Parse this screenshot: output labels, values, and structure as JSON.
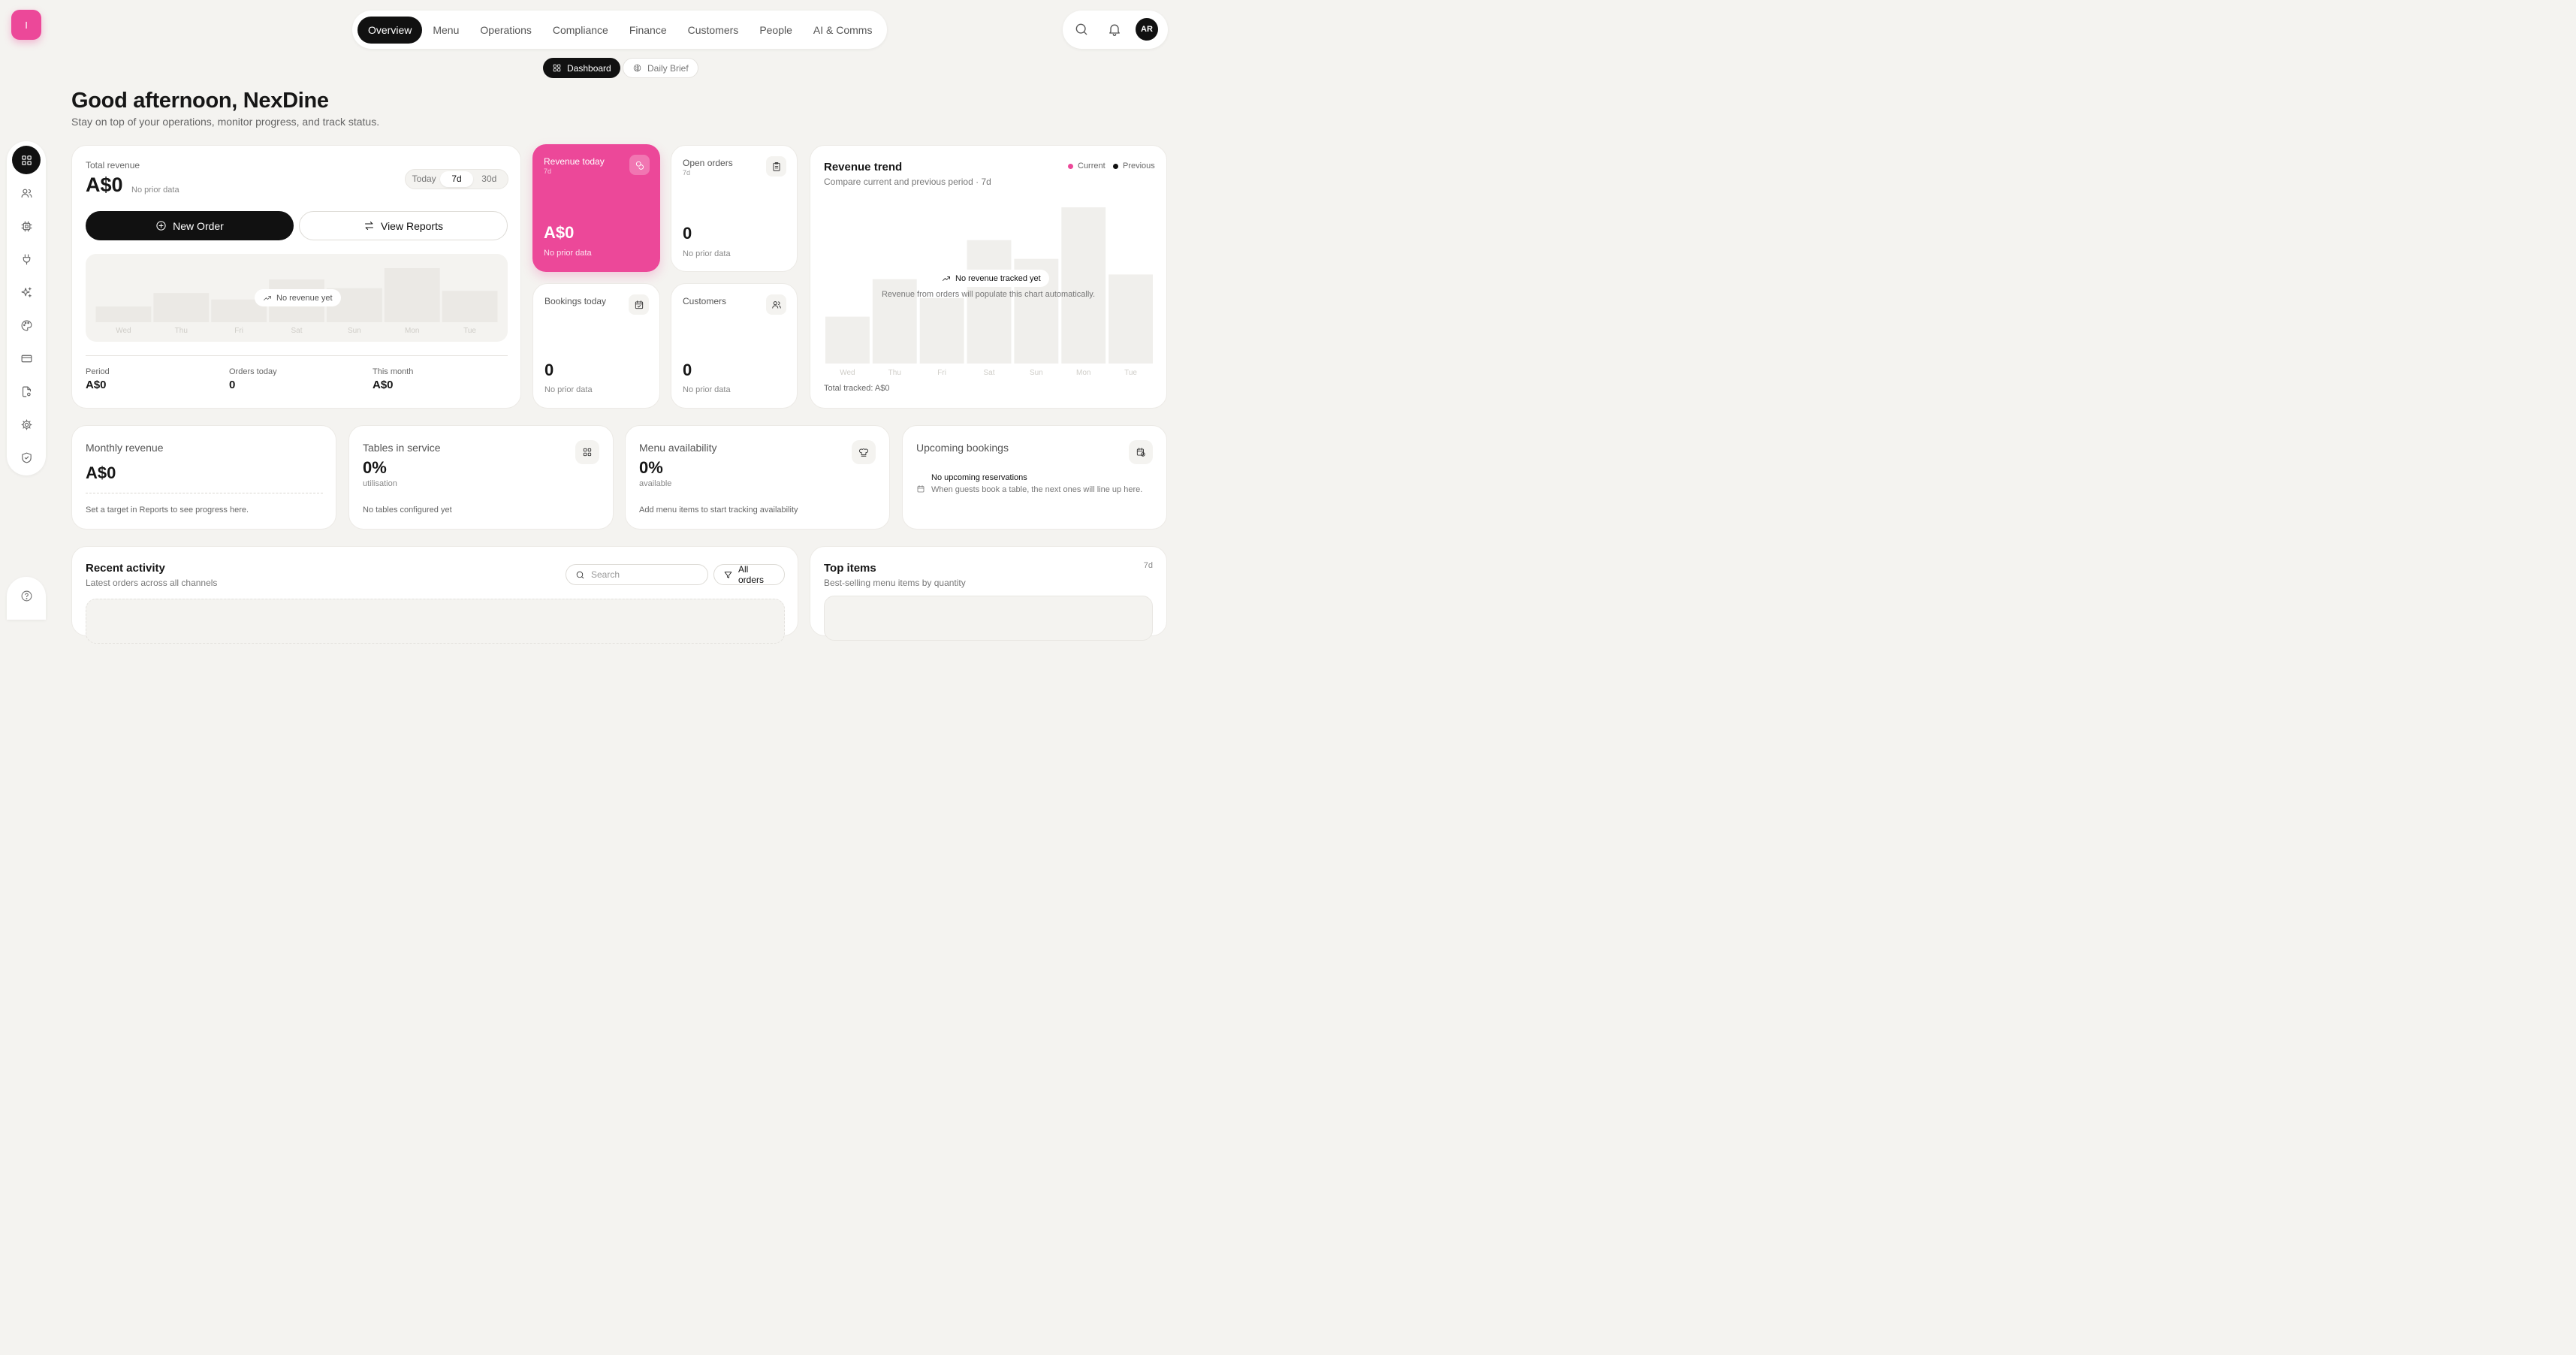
{
  "logo": {
    "letter": "I",
    "color": "#ec4899"
  },
  "nav": {
    "tabs": [
      {
        "label": "Overview",
        "active": true
      },
      {
        "label": "Menu"
      },
      {
        "label": "Operations"
      },
      {
        "label": "Compliance"
      },
      {
        "label": "Finance"
      },
      {
        "label": "Customers"
      },
      {
        "label": "People"
      },
      {
        "label": "AI & Comms"
      }
    ]
  },
  "topright": {
    "search_icon": "search-icon",
    "bell_icon": "bell-icon",
    "avatar": "AR"
  },
  "subtabs": [
    {
      "label": "Dashboard",
      "icon": "grid-icon",
      "active": true
    },
    {
      "label": "Daily Brief",
      "icon": "brain-icon"
    }
  ],
  "greeting": {
    "title": "Good afternoon, NexDine",
    "subtitle": "Stay on top of your operations, monitor progress, and track status."
  },
  "sidebar": {
    "items": [
      {
        "icon": "grid-icon",
        "active": true
      },
      {
        "icon": "users-icon"
      },
      {
        "icon": "chip-icon"
      },
      {
        "icon": "plug-icon"
      },
      {
        "icon": "sparkles-icon"
      },
      {
        "icon": "palette-icon"
      },
      {
        "icon": "card-icon"
      },
      {
        "icon": "file-settings-icon"
      },
      {
        "icon": "gear-icon"
      },
      {
        "icon": "shield-check-icon"
      }
    ],
    "help_icon": "help-icon"
  },
  "total_revenue": {
    "label": "Total revenue",
    "value": "A$0",
    "note": "No prior data",
    "range_options": [
      "Today",
      "7d",
      "30d"
    ],
    "range_selected": "7d",
    "new_order_label": "New Order",
    "view_reports_label": "View Reports",
    "empty_label": "No revenue yet",
    "footer": [
      {
        "label": "Period",
        "value": "A$0"
      },
      {
        "label": "Orders today",
        "value": "0"
      },
      {
        "label": "This month",
        "value": "A$0"
      }
    ]
  },
  "stats": {
    "revenue_today": {
      "title": "Revenue today",
      "period": "7d",
      "value": "A$0",
      "sub": "No prior data"
    },
    "open_orders": {
      "title": "Open orders",
      "period": "7d",
      "value": "0",
      "sub": "No prior data"
    },
    "bookings_today": {
      "title": "Bookings today",
      "value": "0",
      "sub": "No prior data"
    },
    "customers": {
      "title": "Customers",
      "value": "0",
      "sub": "No prior data"
    }
  },
  "revenue_trend": {
    "title": "Revenue trend",
    "subtitle": "Compare current and previous period · 7d",
    "legend": [
      {
        "name": "Current",
        "color": "#ec4899"
      },
      {
        "name": "Previous",
        "color": "#111111"
      }
    ],
    "empty_title": "No revenue tracked yet",
    "empty_sub": "Revenue from orders will populate this chart automatically.",
    "total": "Total tracked: A$0"
  },
  "monthly_revenue": {
    "title": "Monthly revenue",
    "value": "A$0",
    "progress": 0,
    "foot": "Set a target in Reports to see progress here."
  },
  "tables_in_service": {
    "title": "Tables in service",
    "value": "0%",
    "unit": "utilisation",
    "foot": "No tables configured yet"
  },
  "menu_availability": {
    "title": "Menu availability",
    "value": "0%",
    "unit": "available",
    "foot": "Add menu items to start tracking availability"
  },
  "upcoming_bookings": {
    "title": "Upcoming bookings",
    "empty_title": "No upcoming reservations",
    "empty_sub": "When guests book a table, the next ones will line up here."
  },
  "recent_activity": {
    "title": "Recent activity",
    "subtitle": "Latest orders across all channels",
    "search_placeholder": "Search",
    "filter_label": "All orders"
  },
  "top_items": {
    "title": "Top items",
    "subtitle": "Best-selling menu items by quantity",
    "period": "7d"
  },
  "chart_data": [
    {
      "type": "bar",
      "title": "",
      "categories": [
        "Wed",
        "Thu",
        "Fri",
        "Sat",
        "Sun",
        "Mon",
        "Tue"
      ],
      "series": [
        {
          "values": [
            0,
            0,
            0,
            0,
            0,
            0,
            0
          ]
        }
      ],
      "placeholder_levels": [
        0.29,
        0.54,
        0.42,
        0.79,
        0.63,
        1.0,
        0.58
      ],
      "ylim": [
        0,
        1
      ]
    },
    {
      "type": "bar",
      "title": "Revenue trend",
      "categories": [
        "Wed",
        "Thu",
        "Fri",
        "Sat",
        "Sun",
        "Mon",
        "Tue"
      ],
      "series": [
        {
          "name": "Current",
          "values": [
            0,
            0,
            0,
            0,
            0,
            0,
            0
          ]
        },
        {
          "name": "Previous",
          "values": [
            0,
            0,
            0,
            0,
            0,
            0,
            0
          ]
        }
      ],
      "placeholder_levels": [
        0.3,
        0.54,
        0.42,
        0.79,
        0.67,
        1.0,
        0.57
      ],
      "ylim": [
        0,
        1
      ]
    }
  ]
}
